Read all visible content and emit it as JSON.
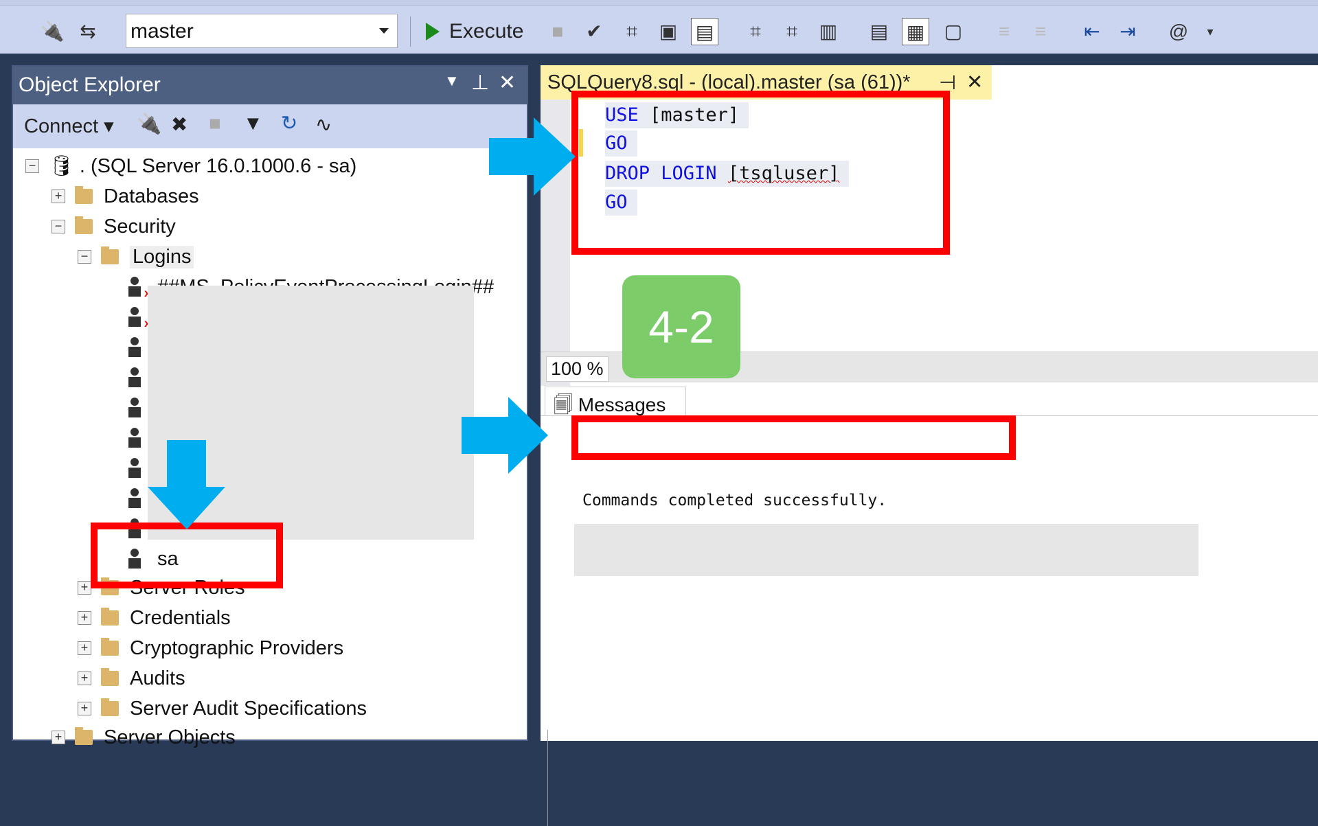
{
  "toolbar": {
    "database": "master",
    "execute_label": "Execute"
  },
  "object_explorer": {
    "title": "Object Explorer",
    "connect_label": "Connect",
    "server": ". (SQL Server 16.0.1000.6 - sa)",
    "nodes": {
      "databases": "Databases",
      "security": "Security",
      "logins": "Logins",
      "server_roles": "Server Roles",
      "credentials": "Credentials",
      "crypto": "Cryptographic Providers",
      "audits": "Audits",
      "audit_specs": "Server Audit Specifications",
      "server_objects": "Server Objects"
    },
    "logins": [
      "##MS_PolicyEventProcessingLogin##",
      "sa"
    ]
  },
  "editor": {
    "tab_title": "SQLQuery8.sql - (local).master (sa (61))*",
    "code": {
      "l1_kw": "USE",
      "l1_rest": "[master]",
      "l2": "GO",
      "l3_kw": "DROP LOGIN",
      "l3_rest": "[tsqluser]",
      "l4": "GO"
    },
    "zoom": "100 %",
    "messages_tab": "Messages",
    "message": "Commands completed successfully."
  },
  "annotation": {
    "step_badge": "4-2",
    "arrow_color": "#00aeef",
    "box_color": "#ff0000",
    "badge_color": "#7ccc6a"
  }
}
